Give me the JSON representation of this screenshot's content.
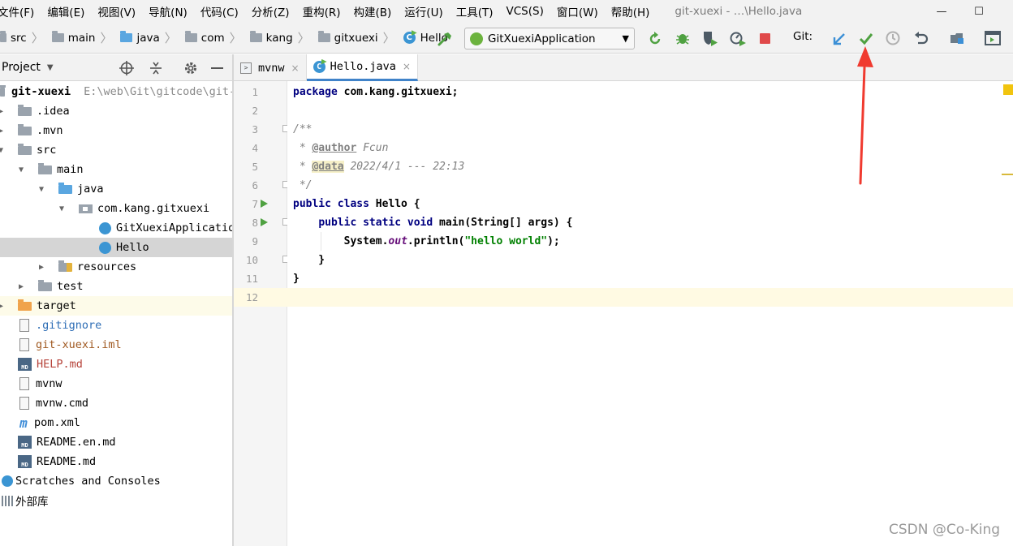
{
  "menu": {
    "items": [
      "文件(F)",
      "编辑(E)",
      "视图(V)",
      "导航(N)",
      "代码(C)",
      "分析(Z)",
      "重构(R)",
      "构建(B)",
      "运行(U)",
      "工具(T)",
      "VCS(S)",
      "窗口(W)",
      "帮助(H)"
    ],
    "window_title": "git-xuexi - …\\Hello.java",
    "minimize": "—",
    "maximize": "☐"
  },
  "breadcrumb": [
    "src",
    "main",
    "java",
    "com",
    "kang",
    "gitxuexi",
    "Hello"
  ],
  "toolbar": {
    "run_config": "GitXuexiApplication",
    "git_label": "Git:"
  },
  "project": {
    "title": "Project",
    "root_name": "git-xuexi",
    "root_path": "E:\\web\\Git\\gitcode\\git-",
    "items": [
      {
        "label": ".idea"
      },
      {
        "label": ".mvn"
      },
      {
        "label": "src"
      },
      {
        "label": "main"
      },
      {
        "label": "java"
      },
      {
        "label": "com.kang.gitxuexi"
      },
      {
        "label": "GitXuexiApplicatio"
      },
      {
        "label": "Hello"
      },
      {
        "label": "resources"
      },
      {
        "label": "test"
      },
      {
        "label": "target"
      },
      {
        "label": ".gitignore"
      },
      {
        "label": "git-xuexi.iml"
      },
      {
        "label": "HELP.md"
      },
      {
        "label": "mvnw"
      },
      {
        "label": "mvnw.cmd"
      },
      {
        "label": "pom.xml"
      },
      {
        "label": "README.en.md"
      },
      {
        "label": "README.md"
      },
      {
        "label": "Scratches and Consoles"
      },
      {
        "label": "外部库"
      }
    ]
  },
  "editor": {
    "tabs": [
      {
        "label": "mvnw",
        "close": "×"
      },
      {
        "label": "Hello.java",
        "close": "×"
      }
    ],
    "line_numbers": [
      "1",
      "2",
      "3",
      "4",
      "5",
      "6",
      "7",
      "8",
      "9",
      "10",
      "11",
      "12"
    ],
    "code": {
      "l1_kw": "package",
      "l1_rest": " com.kang.gitxuexi;",
      "l3": "/**",
      "l4_star": " * ",
      "l4_tag": "@author",
      "l4_rest": " Fcun",
      "l5_star": " * ",
      "l5_tag": "@data",
      "l5_rest": " 2022/4/1 --- 22:13",
      "l6": " */",
      "l7_kw": "public class",
      "l7_rest": " Hello {",
      "l8_indent": "    ",
      "l8_kw": "public static void",
      "l8_rest": " main(String[] args) {",
      "l9_indent": "        ",
      "l9_a": "System.",
      "l9_fld": "out",
      "l9_b": ".println(",
      "l9_str": "\"hello world\"",
      "l9_c": ");",
      "l10": "    }",
      "l11": "}"
    }
  },
  "watermark": "CSDN @Co-King",
  "colors": {
    "accent_blue": "#3b95d3",
    "git_check_green": "#4fa141",
    "annotation_arrow": "#f03a2f",
    "stop_red": "#e0494a"
  }
}
